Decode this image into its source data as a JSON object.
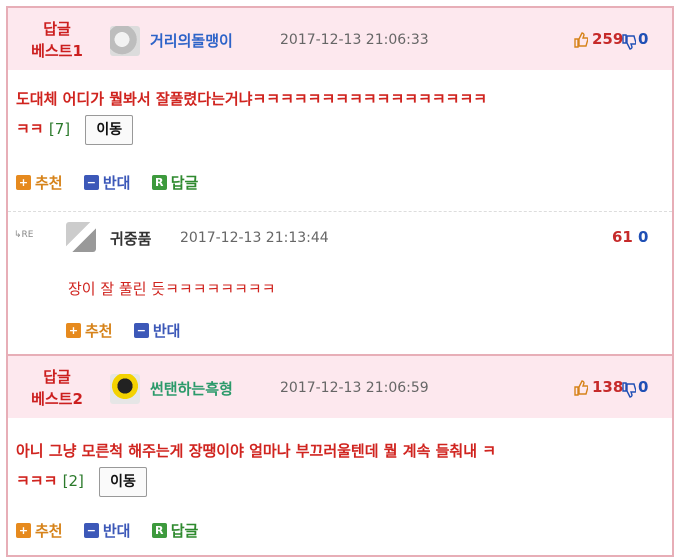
{
  "comments": [
    {
      "best_label_line1": "답글",
      "best_label_line2": "베스트1",
      "nickname": "거리의돌맹이",
      "date": "2017-12-13 21:06:33",
      "up_count": "259",
      "down_count": "0",
      "text_line1": "도대체 어디가 뭘봐서 잘풀렸다는거냐ㅋㅋㅋㅋㅋㅋㅋㅋㅋㅋㅋㅋㅋㅋㅋㅋㅋ",
      "text_line2": "ㅋㅋ",
      "ref": "[7]",
      "move_label": "이동",
      "recommend_label": "추천",
      "oppose_label": "반대",
      "reply_label": "답글",
      "nick_color": "#2d63c8"
    },
    {
      "best_label_line1": "답글",
      "best_label_line2": "베스트2",
      "nickname": "썬탠하는흑형",
      "date": "2017-12-13 21:06:59",
      "up_count": "138",
      "down_count": "0",
      "text_line1": "아니 그냥 모른척 해주는게 장땡이야 얼마나 부끄러울텐데 뭘 계속 들춰내 ㅋ",
      "text_line2": "ㅋㅋㅋ",
      "ref": "[2]",
      "move_label": "이동",
      "recommend_label": "추천",
      "oppose_label": "반대",
      "reply_label": "답글",
      "nick_color": "#2b9a6a"
    }
  ],
  "reply": {
    "re_mark": "RE",
    "nickname": "귀중품",
    "date": "2017-12-13 21:13:44",
    "up_count": "61",
    "down_count": "0",
    "text": "장이 잘 풀린 듯ㅋㅋㅋㅋㅋㅋㅋㅋ",
    "recommend_label": "추천",
    "oppose_label": "반대"
  },
  "icons": {
    "recommend": "plus-icon",
    "oppose": "minus-icon",
    "reply": "r-icon",
    "thumb_up": "thumb-up-icon",
    "thumb_down": "thumb-down-icon"
  }
}
